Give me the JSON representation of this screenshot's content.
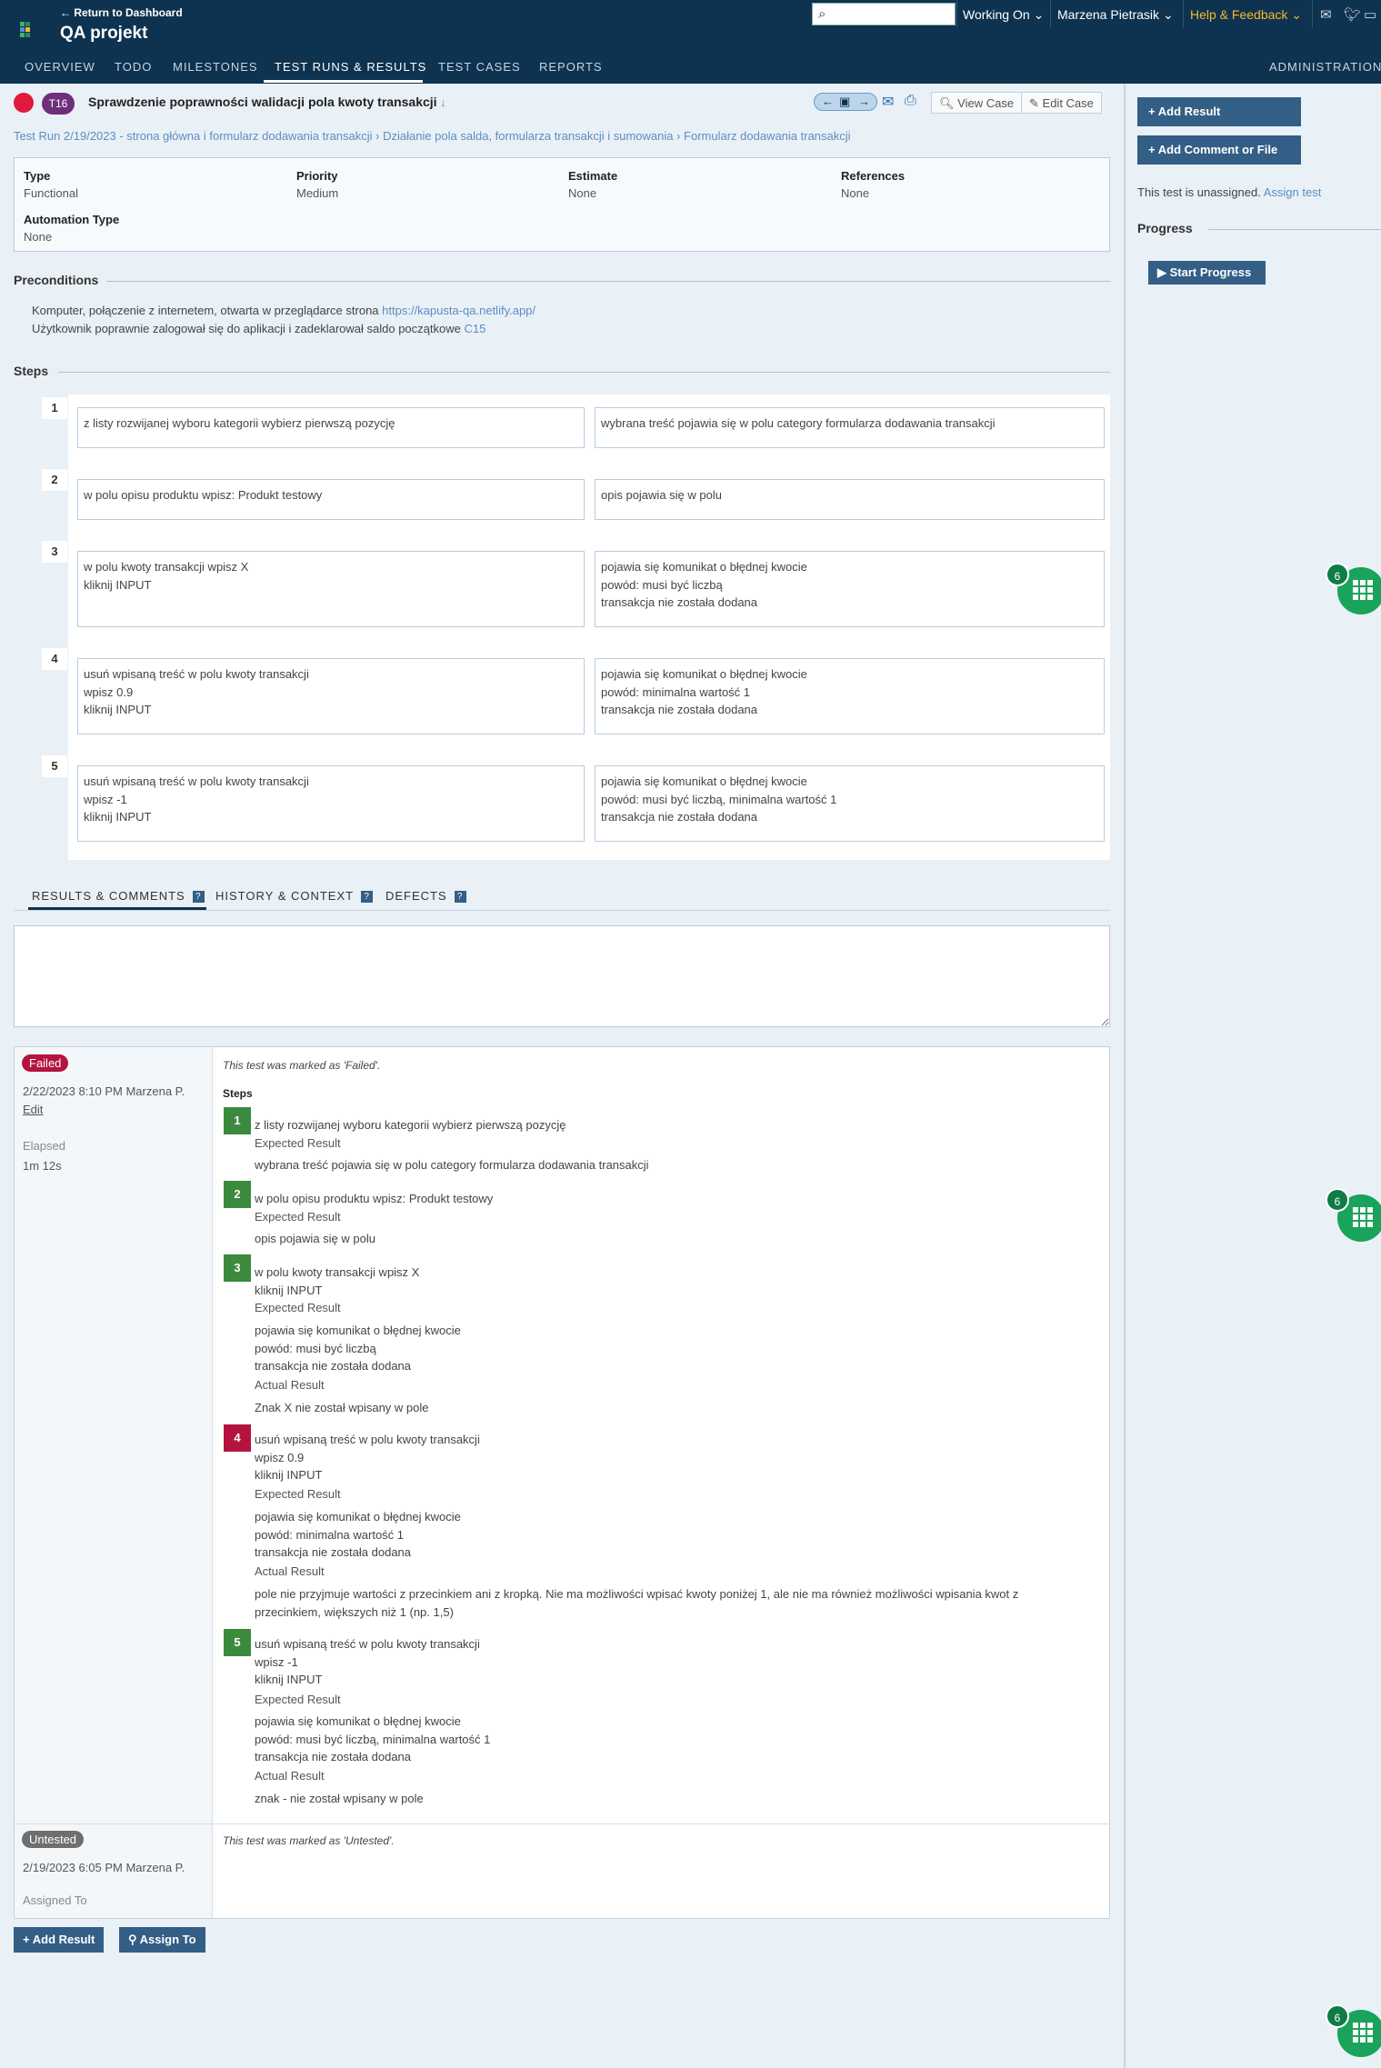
{
  "header": {
    "back_link": "← Return to Dashboard",
    "project": "QA projekt",
    "search_placeholder": "",
    "working_on": "Working On",
    "user": "Marzena Pietrasik",
    "help": "Help & Feedback"
  },
  "nav": {
    "tabs": [
      "OVERVIEW",
      "TODO",
      "MILESTONES",
      "TEST RUNS & RESULTS",
      "TEST CASES",
      "REPORTS"
    ],
    "admin": "ADMINISTRATION"
  },
  "test": {
    "id": "T16",
    "title": "Sprawdzenie poprawności walidacji pola kwoty transakcji",
    "view_case": "View Case",
    "edit_case": "Edit Case",
    "breadcrumb": "Test Run 2/19/2023 - strona główna i formularz dodawania transakcji › Działanie pola salda, formularza transakcji i sumowania › Formularz dodawania transakcji"
  },
  "info": {
    "type_label": "Type",
    "type": "Functional",
    "priority_label": "Priority",
    "priority": "Medium",
    "estimate_label": "Estimate",
    "estimate": "None",
    "references_label": "References",
    "references": "None",
    "automation_label": "Automation Type",
    "automation": "None"
  },
  "preconditions": {
    "title": "Preconditions",
    "line1": "Komputer, połączenie z internetem, otwarta w przeglądarce strona ",
    "line1_link": "https://kapusta-qa.netlify.app/",
    "line2": "Użytkownik poprawnie zalogował się do aplikacji i zadeklarował saldo początkowe ",
    "line2_link": "C15"
  },
  "steps_title": "Steps",
  "steps": [
    {
      "num": "1",
      "action": "z listy rozwijanej wyboru kategorii wybierz pierwszą pozycję",
      "expected": "wybrana treść pojawia się w polu category formularza dodawania transakcji"
    },
    {
      "num": "2",
      "action": "w polu opisu produktu wpisz: Produkt testowy",
      "expected": "opis pojawia się w polu"
    },
    {
      "num": "3",
      "action": "w polu kwoty transakcji wpisz X\nkliknij INPUT",
      "expected": "pojawia się komunikat o błędnej kwocie\npowód: musi być liczbą\ntransakcja nie została dodana"
    },
    {
      "num": "4",
      "action": "usuń wpisaną treść w polu kwoty transakcji\nwpisz 0.9\nkliknij INPUT",
      "expected": "pojawia się komunikat o błędnej kwocie\npowód: minimalna wartość 1\ntransakcja nie została dodana"
    },
    {
      "num": "5",
      "action": "usuń wpisaną treść w polu kwoty transakcji\nwpisz -1\nkliknij INPUT",
      "expected": "pojawia się komunikat o błędnej kwocie\npowód: musi być liczbą, minimalna wartość 1\ntransakcja nie została dodana"
    }
  ],
  "result_tabs": [
    "RESULTS & COMMENTS",
    "HISTORY & CONTEXT",
    "DEFECTS"
  ],
  "results": {
    "failed": {
      "status": "Failed",
      "date": "2/22/2023 8:10 PM Marzena P.",
      "edit": "Edit",
      "elapsed_label": "Elapsed",
      "elapsed": "1m 12s",
      "note": "This test was marked as 'Failed'.",
      "steps_label": "Steps",
      "expected_label": "Expected Result",
      "actual_label": "Actual Result",
      "rows": [
        {
          "num": "1",
          "action": "z listy rozwijanej wyboru kategorii wybierz pierwszą pozycję",
          "expected": "wybrana treść pojawia się w polu category formularza dodawania transakcji",
          "actual": ""
        },
        {
          "num": "2",
          "action": "w polu opisu produktu wpisz: Produkt testowy",
          "expected": "opis pojawia się w polu",
          "actual": ""
        },
        {
          "num": "3",
          "action": "w polu kwoty transakcji wpisz X\nkliknij INPUT",
          "expected": "pojawia się komunikat o błędnej kwocie\npowód: musi być liczbą\ntransakcja nie została dodana",
          "actual": "Znak X nie został wpisany w pole"
        },
        {
          "num": "4",
          "action": "usuń wpisaną treść w polu kwoty transakcji\nwpisz 0.9\nkliknij INPUT",
          "expected": "pojawia się komunikat o błędnej kwocie\npowód: minimalna wartość 1\ntransakcja nie została dodana",
          "actual": "pole nie przyjmuje wartości z przecinkiem ani z kropką. Nie ma możliwości wpisać kwoty poniżej 1, ale nie ma również możliwości wpisania kwot z\nprzecinkiem, większych niż 1 (np. 1,5)"
        },
        {
          "num": "5",
          "action": "usuń wpisaną treść w polu kwoty transakcji\nwpisz -1\nkliknij INPUT",
          "expected": "pojawia się komunikat o błędnej kwocie\npowód: musi być liczbą, minimalna wartość 1\ntransakcja nie została dodana",
          "actual": "znak - nie został wpisany w pole"
        }
      ]
    },
    "untested": {
      "status": "Untested",
      "date": "2/19/2023 6:05 PM Marzena P.",
      "assigned_label": "Assigned To",
      "note": "This test was marked as 'Untested'."
    }
  },
  "bottom": {
    "add_result": "Add Result",
    "assign_to": "Assign To"
  },
  "sidebar": {
    "add_result": "Add Result",
    "add_comment": "Add Comment or File",
    "unassigned": "This test is unassigned. ",
    "assign_link": "Assign test",
    "progress": "Progress",
    "start_progress": "Start Progress"
  },
  "widget_badge": "6",
  "colors": {
    "failed": "#b5133f",
    "passed": "#3b8a3e",
    "untested": "#6e6e6e",
    "brand": "#0e3350"
  }
}
